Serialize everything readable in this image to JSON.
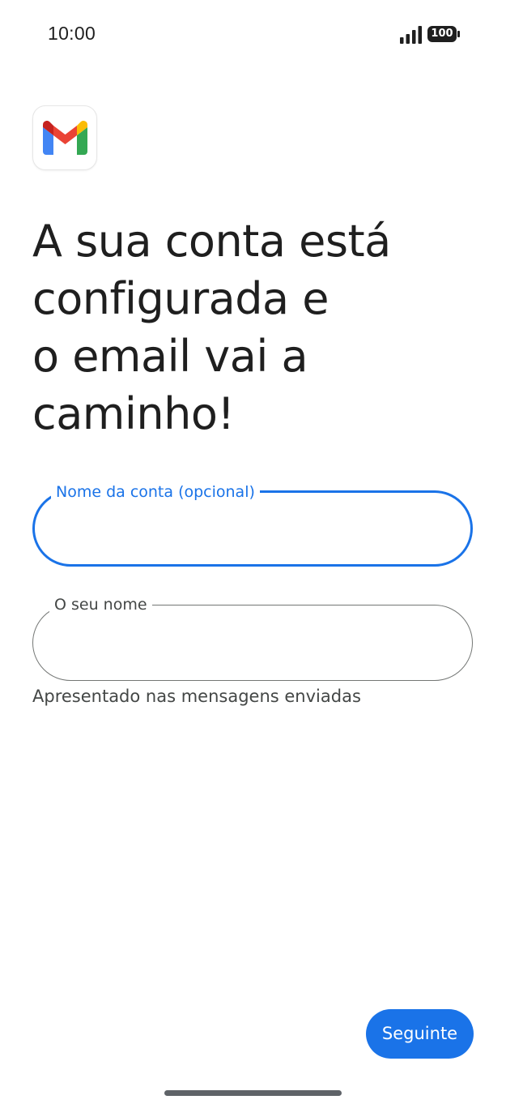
{
  "status_bar": {
    "time": "10:00",
    "battery_level": "100",
    "icons": [
      "signal-icon",
      "battery-icon"
    ]
  },
  "app": {
    "logo_icon": "gmail-logo-icon",
    "colors": {
      "accent": "#1a73e8",
      "text": "#1f1f1f",
      "secondary_text": "#444746",
      "outline": "#747775"
    }
  },
  "headline": {
    "lines": [
      "A sua conta está",
      "configurada e",
      "o email vai a",
      "caminho!"
    ]
  },
  "form": {
    "account_name": {
      "label": "Nome da conta (opcional)",
      "value": "",
      "focused": true
    },
    "your_name": {
      "label": "O seu nome",
      "value": "",
      "helper": "Apresentado nas mensagens enviadas"
    }
  },
  "actions": {
    "next_label": "Seguinte"
  }
}
